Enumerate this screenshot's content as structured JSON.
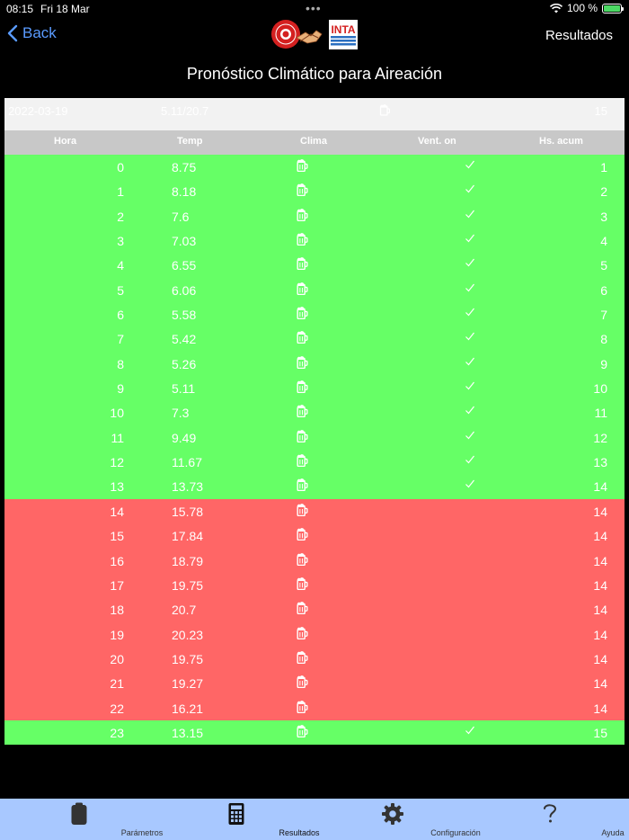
{
  "status": {
    "time": "08:15",
    "date": "Fri 18 Mar",
    "battery": "100 %"
  },
  "nav": {
    "back_label": "Back",
    "right_label": "Resultados",
    "logo_text": "INTA"
  },
  "title": "Pronóstico Climático para Aireación",
  "summary": {
    "date": "2022-03-19",
    "temps": "5.11/20.7",
    "total": "15"
  },
  "columns": {
    "hora": "Hora",
    "temp": "Temp",
    "clima": "Clima",
    "vent": "Vent. on",
    "acum": "Hs. acum"
  },
  "rows": [
    {
      "hora": "0",
      "temp": "8.75",
      "vent": true,
      "acum": "1"
    },
    {
      "hora": "1",
      "temp": "8.18",
      "vent": true,
      "acum": "2"
    },
    {
      "hora": "2",
      "temp": "7.6",
      "vent": true,
      "acum": "3"
    },
    {
      "hora": "3",
      "temp": "7.03",
      "vent": true,
      "acum": "4"
    },
    {
      "hora": "4",
      "temp": "6.55",
      "vent": true,
      "acum": "5"
    },
    {
      "hora": "5",
      "temp": "6.06",
      "vent": true,
      "acum": "6"
    },
    {
      "hora": "6",
      "temp": "5.58",
      "vent": true,
      "acum": "7"
    },
    {
      "hora": "7",
      "temp": "5.42",
      "vent": true,
      "acum": "8"
    },
    {
      "hora": "8",
      "temp": "5.26",
      "vent": true,
      "acum": "9"
    },
    {
      "hora": "9",
      "temp": "5.11",
      "vent": true,
      "acum": "10"
    },
    {
      "hora": "10",
      "temp": "7.3",
      "vent": true,
      "acum": "11"
    },
    {
      "hora": "11",
      "temp": "9.49",
      "vent": true,
      "acum": "12"
    },
    {
      "hora": "12",
      "temp": "11.67",
      "vent": true,
      "acum": "13"
    },
    {
      "hora": "13",
      "temp": "13.73",
      "vent": true,
      "acum": "14"
    },
    {
      "hora": "14",
      "temp": "15.78",
      "vent": false,
      "acum": "14"
    },
    {
      "hora": "15",
      "temp": "17.84",
      "vent": false,
      "acum": "14"
    },
    {
      "hora": "16",
      "temp": "18.79",
      "vent": false,
      "acum": "14"
    },
    {
      "hora": "17",
      "temp": "19.75",
      "vent": false,
      "acum": "14"
    },
    {
      "hora": "18",
      "temp": "20.7",
      "vent": false,
      "acum": "14"
    },
    {
      "hora": "19",
      "temp": "20.23",
      "vent": false,
      "acum": "14"
    },
    {
      "hora": "20",
      "temp": "19.75",
      "vent": false,
      "acum": "14"
    },
    {
      "hora": "21",
      "temp": "19.27",
      "vent": false,
      "acum": "14"
    },
    {
      "hora": "22",
      "temp": "16.21",
      "vent": false,
      "acum": "14"
    },
    {
      "hora": "23",
      "temp": "13.15",
      "vent": true,
      "acum": "15"
    }
  ],
  "colors": {
    "ok": "#66ff66",
    "bad": "#ff6666",
    "tab_bar": "#a8c8ff",
    "link": "#5a9bff"
  },
  "icons": {
    "clima": "cloud-icon",
    "vent": "checkmark-icon"
  },
  "tabs": [
    {
      "label": "Parámetros",
      "icon": "clipboard-icon"
    },
    {
      "label": "Resultados",
      "icon": "calculator-icon"
    },
    {
      "label": "Configuración",
      "icon": "gear-icon"
    },
    {
      "label": "Ayuda",
      "icon": "question-icon"
    }
  ]
}
